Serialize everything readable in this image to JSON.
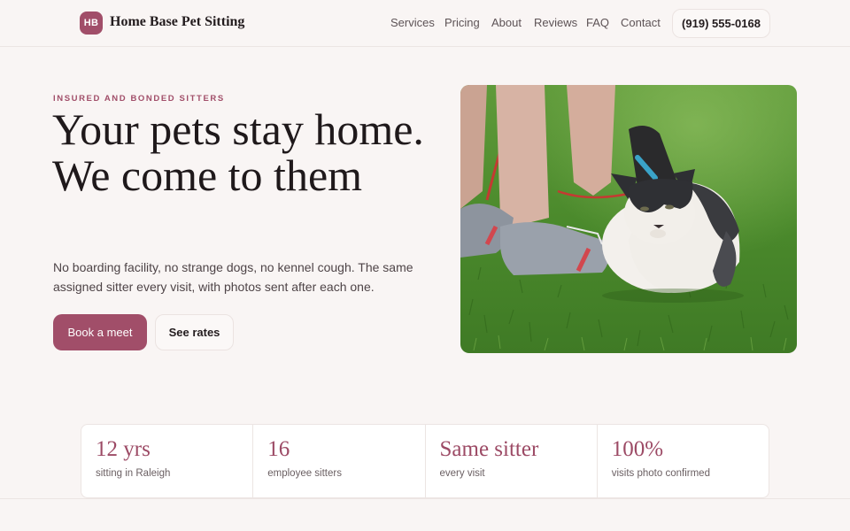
{
  "header": {
    "logo_initials": "HB",
    "brand_name": "Home Base Pet Sitting",
    "nav": [
      "Services",
      "Pricing",
      "About",
      "Reviews",
      "FAQ",
      "Contact"
    ],
    "phone": "(919) 555-0168"
  },
  "hero": {
    "eyebrow": "INSURED AND BONDED SITTERS",
    "headline": "Your pets stay home. We come to them",
    "lead": "No boarding facility, no strange dogs, no kennel cough. The same assigned sitter every visit, with photos sent after each one.",
    "primary_cta": "Book a meet",
    "secondary_cta": "See rates"
  },
  "stats": [
    {
      "value": "12 yrs",
      "label": "sitting in Raleigh"
    },
    {
      "value": "16",
      "label": "employee sitters"
    },
    {
      "value": "Same sitter",
      "label": "every visit"
    },
    {
      "value": "100%",
      "label": "visits photo confirmed"
    }
  ],
  "colors": {
    "accent": "#a14e69",
    "background": "#f9f5f4"
  }
}
